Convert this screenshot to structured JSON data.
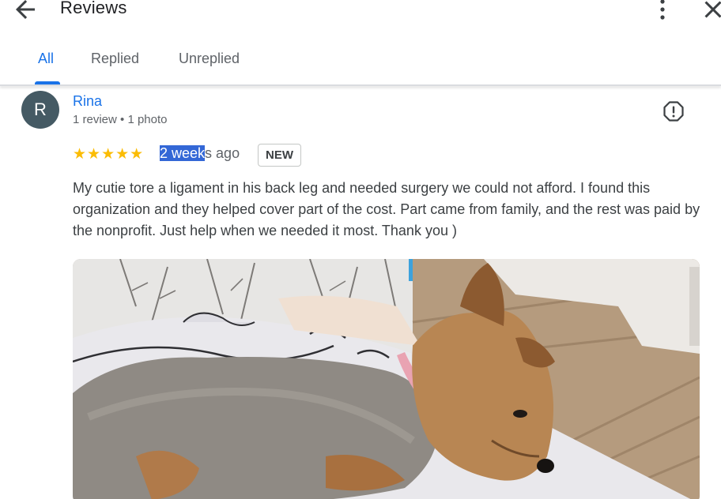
{
  "header": {
    "title": "Reviews",
    "back_icon": "arrow-left-icon",
    "more_icon": "more-vertical-icon",
    "close_icon": "close-icon"
  },
  "tabs": [
    {
      "label": "All",
      "active": true
    },
    {
      "label": "Replied",
      "active": false
    },
    {
      "label": "Unreplied",
      "active": false
    }
  ],
  "review": {
    "avatar_initial": "R",
    "avatar_color": "#455a64",
    "name": "Rina",
    "meta": "1 review • 1 photo",
    "rating": 5,
    "stars": "★★★★★",
    "time_selected": "2 week",
    "time_rest": "s ago",
    "badge": "NEW",
    "text": "My cutie tore a ligament in his back leg and needed surgery we could not afford. I found this organization and they helped cover part of the cost. Part came from family, and the rest was paid by the nonprofit. Just help when we needed it most. Thank you )",
    "report_icon": "report-flag-icon",
    "photo_subject": "yorkshire-terrier-photo"
  },
  "colors": {
    "accent": "#1a73e8",
    "star": "#fbbc04",
    "selection": "#3367d6"
  }
}
